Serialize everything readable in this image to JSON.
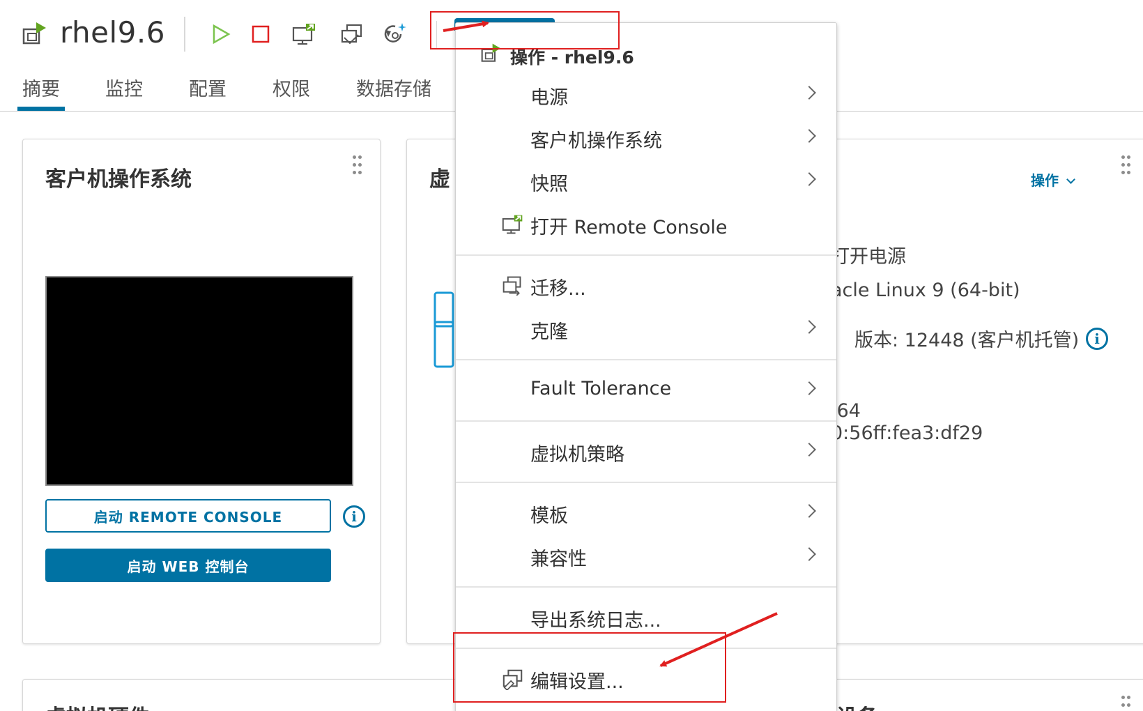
{
  "header": {
    "vm_name": "rhel9.6",
    "toolbar": [
      "power-on-icon",
      "power-off-icon",
      "remote-console-icon",
      "migrate-icon",
      "snapshot-icon"
    ]
  },
  "tabs": [
    {
      "label": "摘要",
      "active": true
    },
    {
      "label": "监控"
    },
    {
      "label": "配置"
    },
    {
      "label": "权限"
    },
    {
      "label": "数据存储"
    }
  ],
  "guest_card": {
    "title": "客户机操作系统",
    "remote_console_button": "启动 REMOTE CONSOLE",
    "web_console_button": "启动 WEB 控制台"
  },
  "vm_card": {
    "title_partial": "虚",
    "actions_link": "操作",
    "power_state": "打开电源",
    "os": "acle Linux 9 (64-bit)",
    "tools_prefix": "，",
    "tools_version": "版本: 12448 (客户机托管)",
    "ipv4": ".64",
    "ipv6": "0:56ff:fea3:df29"
  },
  "hardware_card": {
    "title_partial": "虚拟机硬件",
    "right_partial": "设备"
  },
  "menu": {
    "header": "操作 - rhel9.6",
    "groups": [
      [
        {
          "label": "电源",
          "submenu": true
        },
        {
          "label": "客户机操作系统",
          "submenu": true
        },
        {
          "label": "快照",
          "submenu": true
        },
        {
          "label": "打开 Remote Console",
          "submenu": false,
          "icon": "remote-console-icon"
        }
      ],
      [
        {
          "label": "迁移...",
          "submenu": false,
          "icon": "migrate-icon"
        },
        {
          "label": "克隆",
          "submenu": true
        }
      ],
      [
        {
          "label": "Fault Tolerance",
          "submenu": true
        }
      ],
      [
        {
          "label": "虚拟机策略",
          "submenu": true
        }
      ],
      [
        {
          "label": "模板",
          "submenu": true
        },
        {
          "label": "兼容性",
          "submenu": true
        }
      ],
      [
        {
          "label": "导出系统日志...",
          "submenu": false
        }
      ],
      [
        {
          "label": "编辑设置...",
          "submenu": false,
          "icon": "edit-settings-icon"
        }
      ]
    ]
  },
  "colors": {
    "accent": "#0072a3",
    "annotation": "#e02020",
    "power_on": "#7cc44f",
    "power_off": "#e02020"
  }
}
